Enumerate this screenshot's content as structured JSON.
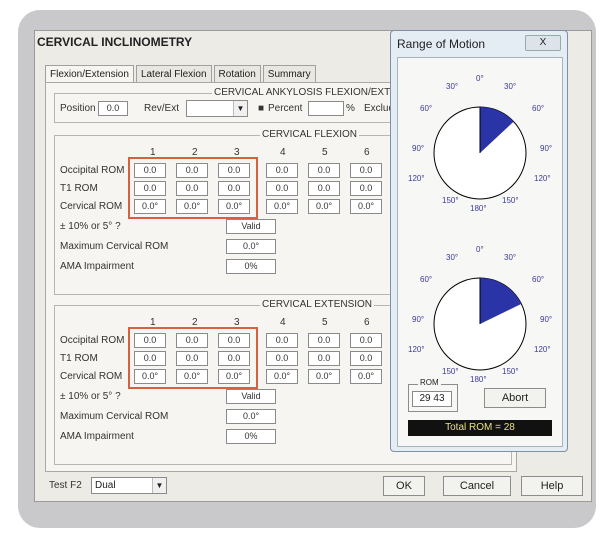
{
  "window": {
    "title": "CERVICAL INCLINOMETRY"
  },
  "tabs": [
    "Flexion/Extension",
    "Lateral Flexion",
    "Rotation",
    "Summary"
  ],
  "ankylosis": {
    "title": "CERVICAL ANKYLOSIS FLEXION/EXTEN",
    "position_label": "Position",
    "position_value": "0.0",
    "rev_ext_label": "Rev/Ext",
    "rev_ext_value": "",
    "percent_label": "Percent",
    "percent_value": "",
    "percent_unit": "%",
    "excludes_label": "Excludes"
  },
  "flexion": {
    "title": "CERVICAL FLEXION",
    "columns": [
      "1",
      "2",
      "3",
      "4",
      "5",
      "6"
    ],
    "rows": [
      {
        "label": "Occipital ROM",
        "values": [
          "0.0",
          "0.0",
          "0.0",
          "0.0",
          "0.0",
          "0.0"
        ]
      },
      {
        "label": "T1 ROM",
        "values": [
          "0.0",
          "0.0",
          "0.0",
          "0.0",
          "0.0",
          "0.0"
        ]
      },
      {
        "label": "Cervical ROM",
        "values": [
          "0.0°",
          "0.0°",
          "0.0°",
          "0.0°",
          "0.0°",
          "0.0°"
        ]
      }
    ],
    "check_label": "± 10% or 5° ?",
    "check_value": "Valid",
    "max_label": "Maximum Cervical ROM",
    "max_value": "0.0°",
    "ama_label": "AMA Impairment",
    "ama_value": "0%"
  },
  "extension": {
    "title": "CERVICAL EXTENSION",
    "columns": [
      "1",
      "2",
      "3",
      "4",
      "5",
      "6"
    ],
    "rows": [
      {
        "label": "Occipital ROM",
        "values": [
          "0.0",
          "0.0",
          "0.0",
          "0.0",
          "0.0",
          "0.0"
        ]
      },
      {
        "label": "T1 ROM",
        "values": [
          "0.0",
          "0.0",
          "0.0",
          "0.0",
          "0.0",
          "0.0"
        ]
      },
      {
        "label": "Cervical ROM",
        "values": [
          "0.0°",
          "0.0°",
          "0.0°",
          "0.0°",
          "0.0°",
          "0.0°"
        ]
      }
    ],
    "check_label": "± 10% or 5° ?",
    "check_value": "Valid",
    "max_label": "Maximum Cervical ROM",
    "max_value": "0.0°",
    "ama_label": "AMA Impairment",
    "ama_value": "0%"
  },
  "bottom": {
    "test_label": "Test F2",
    "test_value": "Dual",
    "ok": "OK",
    "cancel": "Cancel",
    "help": "Help"
  },
  "rom_dialog": {
    "title": "Range of Motion",
    "close_label": "X",
    "dial_labels": {
      "top": "0°",
      "l30": "30°",
      "r30": "30°",
      "l60": "60°",
      "r60": "60°",
      "l90": "90°",
      "r90": "90°",
      "l120": "120°",
      "r120": "120°",
      "l150": "150°",
      "r150": "150°",
      "bottom": "180°"
    },
    "dial1_sector_deg": 47,
    "dial2_sector_deg": 64,
    "rom_group_label": "ROM",
    "rom_values": "29  43",
    "abort": "Abort",
    "total": "Total ROM = 28"
  },
  "colors": {
    "highlight": "#d9603e",
    "sector": "#2b34a6",
    "dial_text": "#3b3b99",
    "total_bg": "#111111",
    "total_fg": "#e8e27a"
  }
}
